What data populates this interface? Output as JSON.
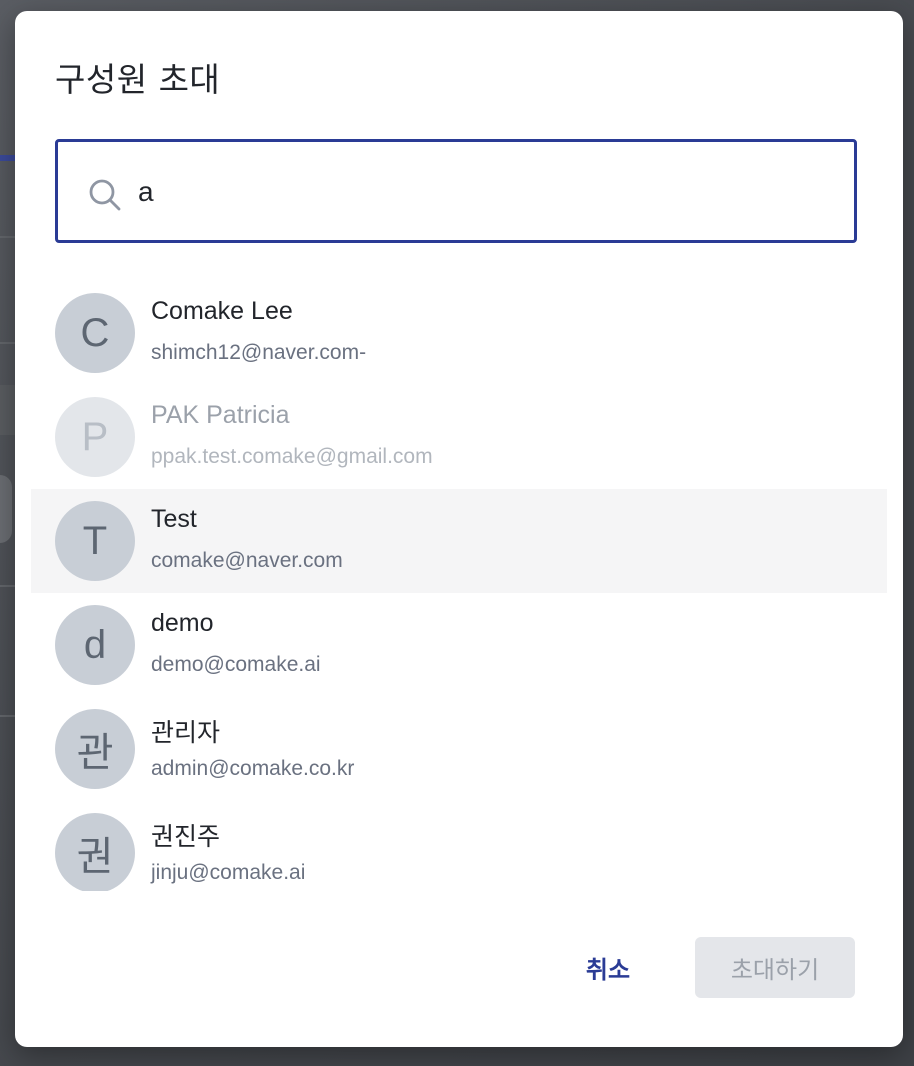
{
  "dialog": {
    "title": "구성원 초대"
  },
  "search": {
    "value": "a",
    "icon": "search-icon"
  },
  "members": [
    {
      "initial": "C",
      "name": "Comake Lee",
      "email": "shimch12@naver.com-",
      "state": "normal"
    },
    {
      "initial": "P",
      "name": "PAK Patricia",
      "email": "ppak.test.comake@gmail.com",
      "state": "disabled"
    },
    {
      "initial": "T",
      "name": "Test",
      "email": "comake@naver.com",
      "state": "hovered"
    },
    {
      "initial": "d",
      "name": "demo",
      "email": "demo@comake.ai",
      "state": "normal"
    },
    {
      "initial": "관",
      "name": "관리자",
      "email": "admin@comake.co.kr",
      "state": "normal"
    },
    {
      "initial": "권",
      "name": "권진주",
      "email": "jinju@comake.ai",
      "state": "normal"
    }
  ],
  "actions": {
    "cancel_label": "취소",
    "invite_label": "초대하기"
  },
  "colors": {
    "accent": "#2a3b95",
    "avatar_bg": "#c8ced6",
    "hover_bg": "#f5f5f6",
    "disabled_button_bg": "#e4e6ea"
  }
}
